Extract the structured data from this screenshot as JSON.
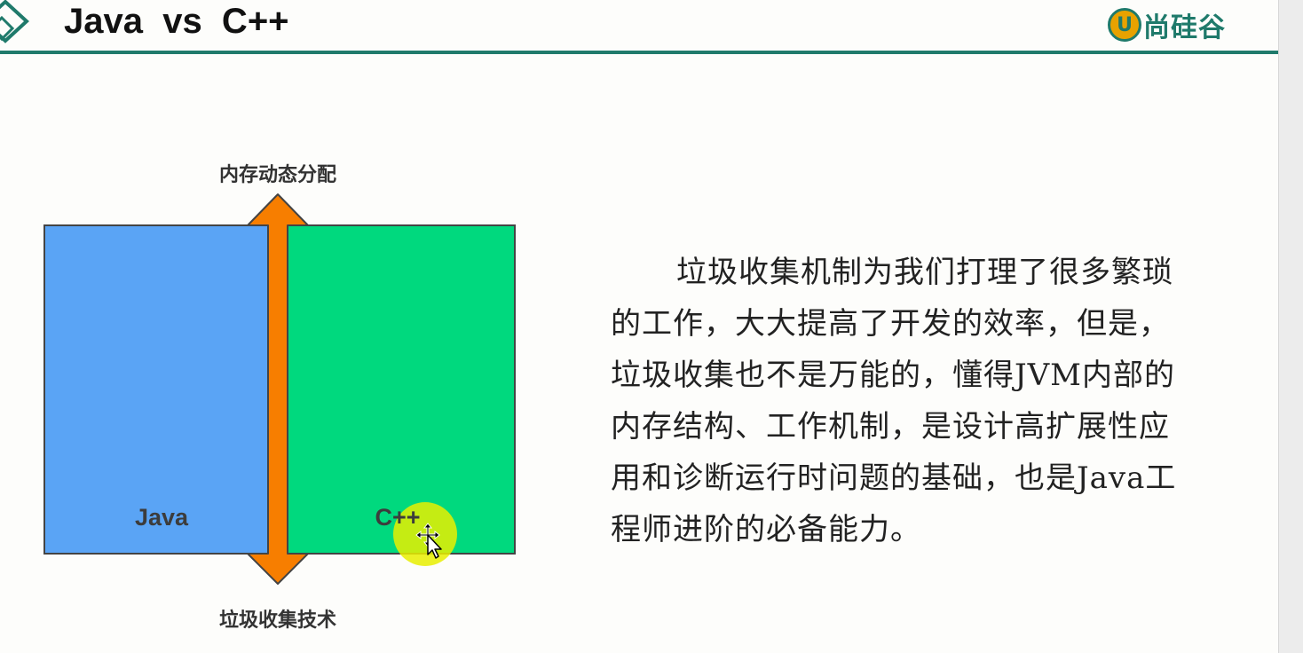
{
  "header": {
    "title": "Java  vs  C++",
    "logo_glyph": "U",
    "logo_text": "尚硅谷",
    "accent_color": "#1f7a6b"
  },
  "diagram": {
    "top_label": "内存动态分配",
    "bottom_label": "垃圾收集技术",
    "left_box": {
      "label": "Java",
      "color": "#5aa4f5"
    },
    "right_box": {
      "label": "C++",
      "color": "#00d97e"
    },
    "arrow_color": "#f77e00"
  },
  "paragraph": {
    "text": "垃圾收集机制为我们打理了很多繁琐的工作，大大提高了开发的效率，但是，垃圾收集也不是万能的，懂得JVM内部的内存结构、工作机制，是设计高扩展性应用和诊断运行时问题的基础，也是Java工程师进阶的必备能力。"
  },
  "cursor": {
    "icon": "move-cursor-icon",
    "highlight_color": "#e8ef00"
  }
}
